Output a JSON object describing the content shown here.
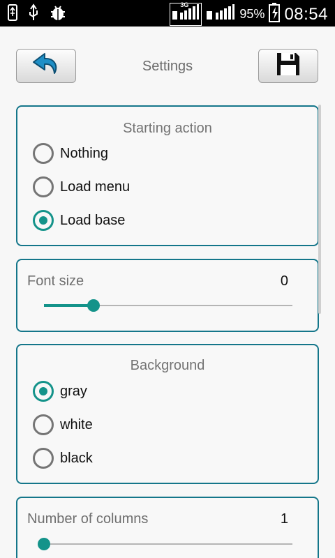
{
  "status_bar": {
    "network_type": "3G",
    "battery_percent": "95%",
    "time": "08:54",
    "icons": [
      "usb-icon",
      "usb-icon",
      "android-debug-icon",
      "signal-icon",
      "signal-icon",
      "battery-charging-icon"
    ]
  },
  "header": {
    "title": "Settings",
    "back_icon": "undo-arrow-icon",
    "save_icon": "floppy-disk-icon"
  },
  "starting_action": {
    "title": "Starting action",
    "options": [
      "Nothing",
      "Load menu",
      "Load base"
    ],
    "selected": "Load base"
  },
  "font_size": {
    "label": "Font size",
    "value": "0",
    "slider_fraction": 0.2
  },
  "background": {
    "title": "Background",
    "options": [
      "gray",
      "white",
      "black"
    ],
    "selected": "gray"
  },
  "columns": {
    "label": "Number of columns",
    "value": "1",
    "slider_fraction": 0.0
  },
  "colors": {
    "accent": "#14938a",
    "border": "#14768a"
  }
}
